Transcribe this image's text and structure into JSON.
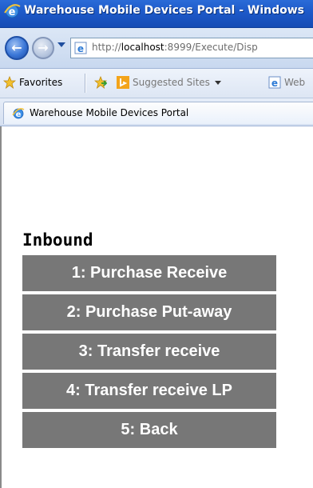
{
  "window": {
    "title": "Warehouse Mobile Devices Portal - Windows",
    "icon": "ie-icon"
  },
  "navigation": {
    "back_icon": "back-arrow-icon",
    "forward_icon": "forward-arrow-icon",
    "address_prefix": "http://",
    "address_host": "localhost",
    "address_rest": ":8999/Execute/Disp"
  },
  "favorites_bar": {
    "favorites_label": "Favorites",
    "suggested_sites_label": "Suggested Sites",
    "web_slice_label": "Web"
  },
  "tab": {
    "title": "Warehouse Mobile Devices Portal"
  },
  "page": {
    "heading": "Inbound",
    "menu": [
      {
        "label": "1: Purchase Receive"
      },
      {
        "label": "2: Purchase Put-away"
      },
      {
        "label": "3: Transfer receive"
      },
      {
        "label": "4: Transfer receive LP"
      },
      {
        "label": "5: Back"
      }
    ]
  },
  "colors": {
    "menu_button": "#777777",
    "title_bar": "#1d59c8"
  }
}
